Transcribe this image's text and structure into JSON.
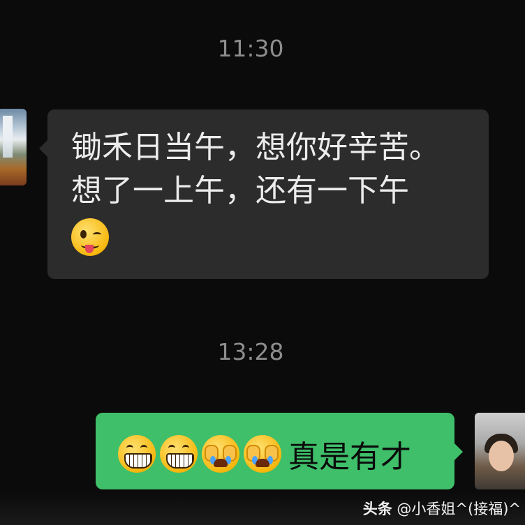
{
  "timestamps": [
    "11:30",
    "13:28"
  ],
  "incoming": {
    "line1": "锄禾日当午，想你好辛苦。",
    "line2": "想了一上午，还有一下午",
    "emoji": "winking-face-tongue"
  },
  "outgoing": {
    "emojis": [
      "grinning-face",
      "grinning-face",
      "crying-face",
      "crying-face"
    ],
    "text": "真是有才"
  },
  "watermark": {
    "brand": "头条",
    "handle": "@小香姐^(接福)^"
  },
  "colors": {
    "background": "#0b0b0b",
    "incoming_bubble": "#2c2c2c",
    "outgoing_bubble": "#3fbf6a",
    "timestamp": "#8d8d8d"
  }
}
